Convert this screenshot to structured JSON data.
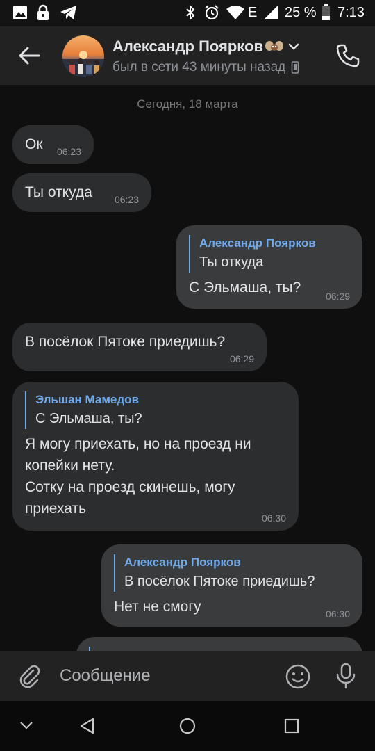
{
  "status_bar": {
    "network_type": "E",
    "battery": "25 %",
    "time": "7:13"
  },
  "header": {
    "name": "Александр Поярков",
    "status": "был в сети 43 минуты назад"
  },
  "chat": {
    "date_separator": "Сегодня, 18 марта",
    "messages": [
      {
        "text": "Ок",
        "time": "06:23"
      },
      {
        "text": "Ты откуда",
        "time": "06:23"
      },
      {
        "reply_name": "Александр Поярков",
        "reply_text": "Ты откуда",
        "text": "С Эльмаша, ты?",
        "time": "06:29"
      },
      {
        "text": "В посёлок Пятоке приедишь?",
        "time": "06:29"
      },
      {
        "reply_name": "Эльшан Мамедов",
        "reply_text": "С Эльмаша, ты?",
        "text": "Я могу приехать, но на проезд ни\nкопейки нету.\nСотку на проезд скинешь, могу\nприехать",
        "time": "06:30"
      },
      {
        "reply_name": "Александр Поярков",
        "reply_text": "В посёлок Пятоке приедишь?",
        "text": "Нет не смогу",
        "time": "06:30"
      }
    ]
  },
  "composer": {
    "placeholder": "Сообщение"
  },
  "colors": {
    "accent": "#71aaeb",
    "chat_background": "#0f0f0f",
    "header_background": "#222222",
    "incoming_bubble": "#2c2d2e",
    "outgoing_bubble": "#3a3b3c"
  },
  "icons": [
    "image-icon",
    "lock-icon",
    "telegram-icon",
    "bluetooth-icon",
    "alarm-icon",
    "wifi-icon",
    "signal-icon",
    "battery-icon",
    "back-arrow-icon",
    "chevron-down-icon",
    "mobile-device-icon",
    "phone-icon",
    "paperclip-icon",
    "emoji-icon",
    "microphone-icon",
    "nav-hide-icon",
    "nav-back-icon",
    "nav-home-icon",
    "nav-recents-icon"
  ]
}
